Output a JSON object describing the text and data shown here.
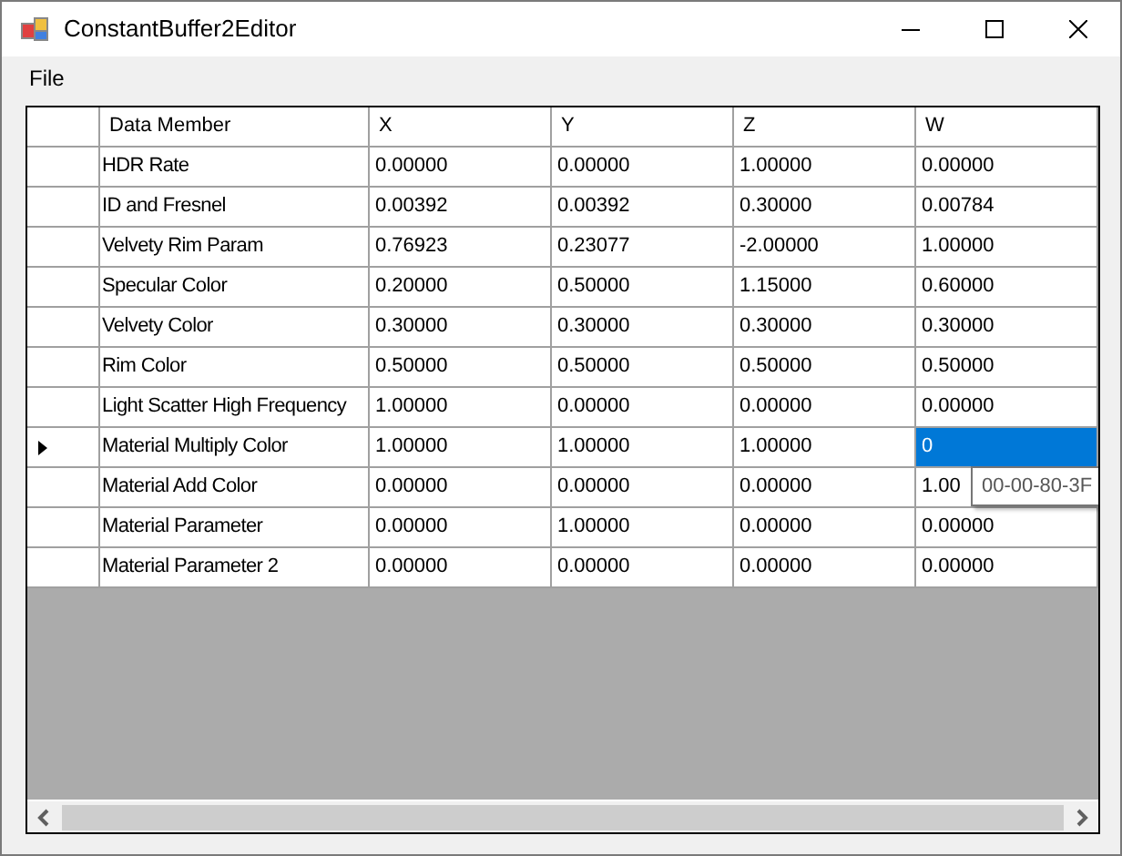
{
  "window": {
    "title": "ConstantBuffer2Editor"
  },
  "menu": [
    "File"
  ],
  "grid": {
    "columns": [
      "Data Member",
      "X",
      "Y",
      "Z",
      "W"
    ],
    "rows": [
      {
        "current": false,
        "cells": [
          {
            "text": "HDR Rate",
            "selected": false
          },
          {
            "text": "0.00000",
            "selected": false
          },
          {
            "text": "0.00000",
            "selected": false
          },
          {
            "text": "1.00000",
            "selected": false
          },
          {
            "text": "0.00000",
            "selected": false
          }
        ]
      },
      {
        "current": false,
        "cells": [
          {
            "text": "ID and Fresnel",
            "selected": false
          },
          {
            "text": "0.00392",
            "selected": false
          },
          {
            "text": "0.00392",
            "selected": false
          },
          {
            "text": "0.30000",
            "selected": false
          },
          {
            "text": "0.00784",
            "selected": false
          }
        ]
      },
      {
        "current": false,
        "cells": [
          {
            "text": "Velvety Rim Param",
            "selected": false
          },
          {
            "text": "0.76923",
            "selected": false
          },
          {
            "text": "0.23077",
            "selected": false
          },
          {
            "text": "-2.00000",
            "selected": false
          },
          {
            "text": "1.00000",
            "selected": false
          }
        ]
      },
      {
        "current": false,
        "cells": [
          {
            "text": "Specular Color",
            "selected": false
          },
          {
            "text": "0.20000",
            "selected": false
          },
          {
            "text": "0.50000",
            "selected": false
          },
          {
            "text": "1.15000",
            "selected": false
          },
          {
            "text": "0.60000",
            "selected": false
          }
        ]
      },
      {
        "current": false,
        "cells": [
          {
            "text": "Velvety Color",
            "selected": false
          },
          {
            "text": "0.30000",
            "selected": false
          },
          {
            "text": "0.30000",
            "selected": false
          },
          {
            "text": "0.30000",
            "selected": false
          },
          {
            "text": "0.30000",
            "selected": false
          }
        ]
      },
      {
        "current": false,
        "cells": [
          {
            "text": "Rim Color",
            "selected": false
          },
          {
            "text": "0.50000",
            "selected": false
          },
          {
            "text": "0.50000",
            "selected": false
          },
          {
            "text": "0.50000",
            "selected": false
          },
          {
            "text": "0.50000",
            "selected": false
          }
        ]
      },
      {
        "current": false,
        "cells": [
          {
            "text": "Light Scatter High Frequency",
            "selected": false
          },
          {
            "text": "1.00000",
            "selected": false
          },
          {
            "text": "0.00000",
            "selected": false
          },
          {
            "text": "0.00000",
            "selected": false
          },
          {
            "text": "0.00000",
            "selected": false
          }
        ]
      },
      {
        "current": true,
        "cells": [
          {
            "text": "Material Multiply Color",
            "selected": false
          },
          {
            "text": "1.00000",
            "selected": false
          },
          {
            "text": "1.00000",
            "selected": false
          },
          {
            "text": "1.00000",
            "selected": false
          },
          {
            "text": "0",
            "selected": true
          }
        ]
      },
      {
        "current": false,
        "cells": [
          {
            "text": "Material Add Color",
            "selected": false
          },
          {
            "text": "0.00000",
            "selected": false
          },
          {
            "text": "0.00000",
            "selected": false
          },
          {
            "text": "0.00000",
            "selected": false
          },
          {
            "text": "1.00",
            "selected": false
          }
        ]
      },
      {
        "current": false,
        "cells": [
          {
            "text": "Material Parameter",
            "selected": false
          },
          {
            "text": "0.00000",
            "selected": false
          },
          {
            "text": "1.00000",
            "selected": false
          },
          {
            "text": "0.00000",
            "selected": false
          },
          {
            "text": "0.00000",
            "selected": false
          }
        ]
      },
      {
        "current": false,
        "cells": [
          {
            "text": "Material Parameter 2",
            "selected": false
          },
          {
            "text": "0.00000",
            "selected": false
          },
          {
            "text": "0.00000",
            "selected": false
          },
          {
            "text": "0.00000",
            "selected": false
          },
          {
            "text": "0.00000",
            "selected": false
          }
        ]
      }
    ],
    "tooltip": "00-00-80-3F"
  }
}
